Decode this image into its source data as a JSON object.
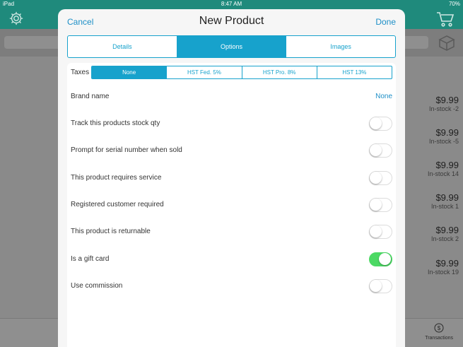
{
  "status": {
    "device": "iPad",
    "wifi_icon": "wifi-icon",
    "time": "8:47 AM",
    "bluetooth_icon": "bluetooth-icon",
    "battery": "70%"
  },
  "background": {
    "products": [
      {
        "price": "$9.99",
        "stock": "In-stock -2"
      },
      {
        "price": "$9.99",
        "stock": "In-stock -5"
      },
      {
        "price": "$9.99",
        "stock": "In-stock 14"
      },
      {
        "price": "$9.99",
        "stock": "In-stock 1"
      },
      {
        "price": "$9.99",
        "stock": "In-stock 2"
      },
      {
        "price": "$9.99",
        "stock": "In-stock 19"
      }
    ],
    "transactions_label": "Transactions"
  },
  "modal": {
    "cancel_label": "Cancel",
    "title": "New Product",
    "done_label": "Done",
    "tabs": [
      {
        "label": "Details",
        "active": false
      },
      {
        "label": "Options",
        "active": true
      },
      {
        "label": "Images",
        "active": false
      }
    ],
    "taxes": {
      "label": "Taxes",
      "options": [
        "None",
        "HST Fed. 5%",
        "HST Pro. 8%",
        "HST 13%"
      ],
      "selected": "None"
    },
    "brand": {
      "label": "Brand name",
      "value": "None"
    },
    "toggles": [
      {
        "label": "Track this products stock qty",
        "on": false
      },
      {
        "label": "Prompt for serial number when sold",
        "on": false
      },
      {
        "label": "This product requires service",
        "on": false
      },
      {
        "label": "Registered customer required",
        "on": false
      },
      {
        "label": "This product is returnable",
        "on": false
      },
      {
        "label": "Is a gift card",
        "on": true
      },
      {
        "label": "Use commission",
        "on": false
      }
    ]
  },
  "colors": {
    "accent": "#17a2cc",
    "link": "#1d8fc7",
    "header_teal": "#1f8a7c",
    "toggle_on": "#4cd964"
  }
}
